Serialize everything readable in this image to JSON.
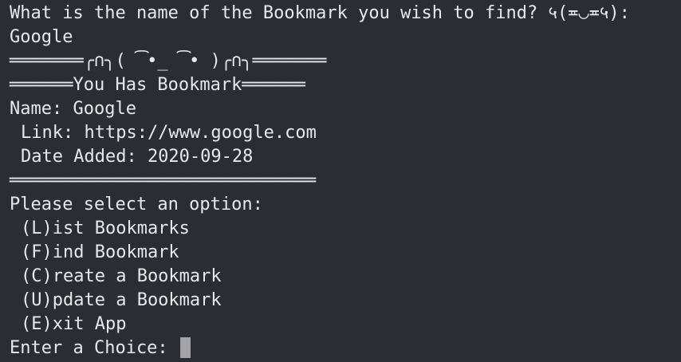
{
  "prompt": "What is the name of the Bookmark you wish to find? ५(≖◡≖५):",
  "input_value": "Google",
  "divider_art": "═══════╭∩╮( ͡•_ ͡• )╭∩╮═══════",
  "heading": "══════You Has Bookmark══════",
  "bookmark": {
    "name": "Name: Google",
    "link": "Link: https://www.google.com",
    "date_added": "Date Added: 2020-09-28"
  },
  "divider": "═════════════════════════════",
  "menu": {
    "title": "Please select an option:",
    "options": [
      "(L)ist Bookmarks",
      "(F)ind Bookmark",
      "(C)reate a Bookmark",
      "(U)pdate a Bookmark",
      "(E)xit App"
    ]
  },
  "choice_prompt": "Enter a Choice: ",
  "colors": {
    "background": "#2b2d35",
    "text": "#e8e8ec",
    "cursor": "#a4a4a8"
  }
}
